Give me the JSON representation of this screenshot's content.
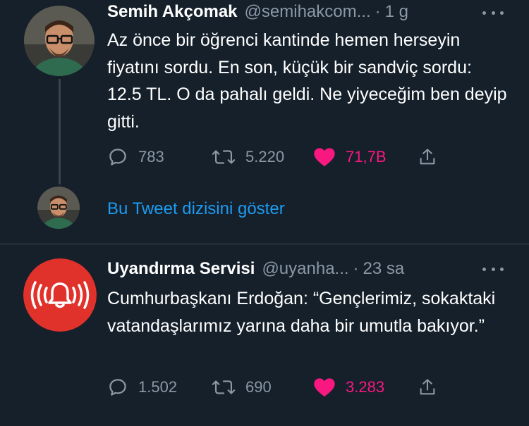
{
  "colors": {
    "background": "#15202b",
    "text": "#ffffff",
    "secondary": "#8b98a5",
    "link": "#1d9bf0",
    "like": "#f91880",
    "alert_avatar": "#e0312b"
  },
  "tweets": [
    {
      "name": "Semih Akçomak",
      "handle": "@semihakcom...",
      "time": "1 g",
      "text": "Az önce bir öğrenci kantinde hemen herseyin fiyatını sordu. En son, küçük bir sandviç sordu: 12.5 TL. O da pahalı geldi. Ne yiyeceğim ben deyip gitti.",
      "replies": "783",
      "retweets": "5.220",
      "likes": "71,7B",
      "liked": true
    },
    {
      "name": "Uyandırma Servisi",
      "handle": "@uyanha...",
      "time": "23 sa",
      "text": "Cumhurbaşkanı Erdoğan: “Gençlerimiz, sokaktaki vatandaşlarımız yarına daha bir umutla bakıyor.”",
      "replies": "1.502",
      "retweets": "690",
      "likes": "3.283",
      "liked": true
    }
  ],
  "thread": {
    "show_label": "Bu Tweet dizisini göster"
  },
  "icons": {
    "reply": "reply-icon",
    "retweet": "retweet-icon",
    "like": "heart-icon",
    "share": "share-icon",
    "more": "more-icon"
  }
}
